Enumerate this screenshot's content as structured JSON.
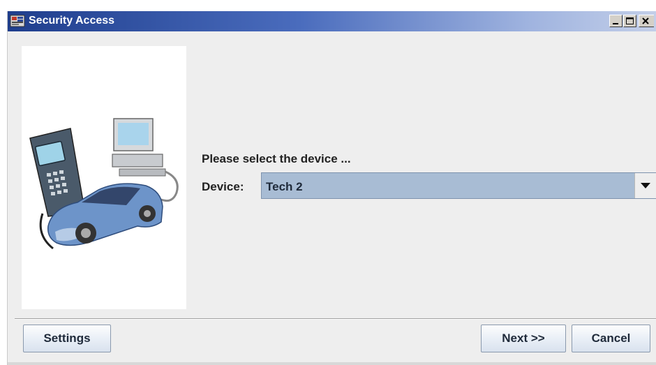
{
  "window": {
    "title": "Security Access",
    "icons": {
      "app": "app-icon",
      "minimize": "minimize-icon",
      "maximize": "maximize-icon",
      "close": "close-icon"
    }
  },
  "illustration": {
    "description_icon": "car-diagnostic-illustration"
  },
  "form": {
    "prompt": "Please select the device ...",
    "device_label": "Device:",
    "device_value": "Tech 2",
    "dropdown_icon": "chevron-down-icon"
  },
  "buttons": {
    "settings": "Settings",
    "next": "Next >>",
    "cancel": "Cancel"
  },
  "colors": {
    "titlebar_start": "#1f3e8d",
    "titlebar_end": "#c3cfe9",
    "select_background": "#a8bcd4",
    "window_background": "#eeeeee"
  }
}
